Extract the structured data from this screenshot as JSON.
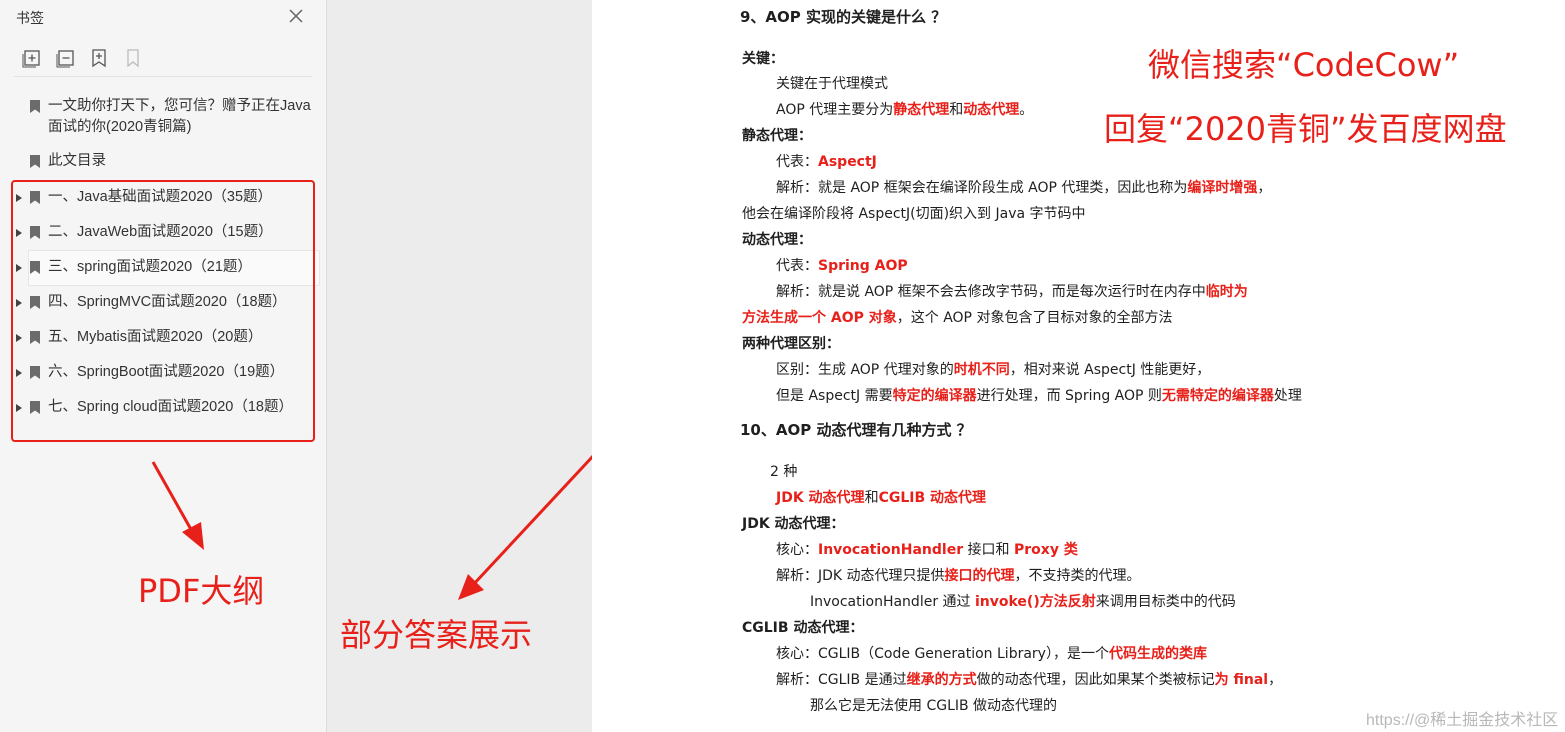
{
  "sidebar": {
    "title": "书签",
    "toolbar": [
      "expand-all-icon",
      "collapse-all-icon",
      "add-bookmark-icon",
      "bookmark-icon"
    ],
    "items": [
      {
        "label": "一文助你打天下，您可信？赠予正在Java面试的你(2020青铜篇)",
        "expandable": false
      },
      {
        "label": "此文目录",
        "expandable": false
      },
      {
        "label": "一、Java基础面试题2020（35题）",
        "expandable": true
      },
      {
        "label": "二、JavaWeb面试题2020（15题）",
        "expandable": true
      },
      {
        "label": "三、spring面试题2020（21题）",
        "expandable": true
      },
      {
        "label": "四、SpringMVC面试题2020（18题）",
        "expandable": true
      },
      {
        "label": "五、Mybatis面试题2020（20题）",
        "expandable": true
      },
      {
        "label": "六、SpringBoot面试题2020（19题）",
        "expandable": true
      },
      {
        "label": "七、Spring cloud面试题2020（18题）",
        "expandable": true
      }
    ]
  },
  "annotations": {
    "outline": "PDF大纲",
    "answers": "部分答案展示",
    "wechat_line1": "微信搜索“CodeCow”",
    "wechat_line2": "回复“2020青铜”发百度网盘",
    "watermark": "https://@稀土掘金技术社区"
  },
  "colors": {
    "accent_red": "#e8201a",
    "sidebar_bg": "#f5f5f5",
    "gutter_bg": "#ececec",
    "page_bg": "#ffffff"
  },
  "document": {
    "lines": [
      [
        {
          "t": "9、AOP 实现的关键是什么 ？",
          "s": "h"
        }
      ],
      [
        {
          "t": "关键：",
          "s": "b"
        }
      ],
      [
        {
          "t": "关键在于代理模式",
          "s": ""
        }
      ],
      [
        {
          "t": "AOP 代理主要分为",
          "s": ""
        },
        {
          "t": "静态代理",
          "s": "r"
        },
        {
          "t": "和",
          "s": ""
        },
        {
          "t": "动态代理",
          "s": "r"
        },
        {
          "t": "。",
          "s": ""
        }
      ],
      [
        {
          "t": "静态代理：",
          "s": "b"
        }
      ],
      [
        {
          "t": "代表：",
          "s": ""
        },
        {
          "t": "AspectJ",
          "s": "r"
        }
      ],
      [
        {
          "t": "解析：就是 AOP 框架会在编译阶段生成 AOP 代理类，因此也称为",
          "s": ""
        },
        {
          "t": "编译时增强",
          "s": "r"
        },
        {
          "t": "，",
          "s": ""
        }
      ],
      [
        {
          "t": "他会在编译阶段将 AspectJ(切面)织入到 Java 字节码中",
          "s": ""
        }
      ],
      [
        {
          "t": "动态代理：",
          "s": "b"
        }
      ],
      [
        {
          "t": "代表：",
          "s": ""
        },
        {
          "t": "Spring AOP",
          "s": "r"
        }
      ],
      [
        {
          "t": "解析：就是说 AOP 框架不会去修改字节码，而是每次运行时在内存中",
          "s": ""
        },
        {
          "t": "临时为",
          "s": "r"
        }
      ],
      [
        {
          "t": "方法生成一个 AOP 对象",
          "s": "r"
        },
        {
          "t": "，这个 AOP 对象包含了目标对象的全部方法",
          "s": ""
        }
      ],
      [
        {
          "t": "两种代理区别：",
          "s": "b"
        }
      ],
      [
        {
          "t": "区别：生成 AOP 代理对象的",
          "s": ""
        },
        {
          "t": "时机不同",
          "s": "r"
        },
        {
          "t": "，相对来说 AspectJ 性能更好，",
          "s": ""
        }
      ],
      [
        {
          "t": "但是 AspectJ 需要",
          "s": ""
        },
        {
          "t": "特定的编译器",
          "s": "r"
        },
        {
          "t": "进行处理，而 Spring AOP 则",
          "s": ""
        },
        {
          "t": "无需特定的编译器",
          "s": "r"
        },
        {
          "t": "处理",
          "s": ""
        }
      ],
      [
        {
          "t": "10、AOP 动态代理有几种方式 ？",
          "s": "h"
        }
      ],
      [
        {
          "t": "2 种",
          "s": ""
        }
      ],
      [
        {
          "t": "JDK 动态代理",
          "s": "r"
        },
        {
          "t": "和",
          "s": ""
        },
        {
          "t": "CGLIB 动态代理",
          "s": "r"
        }
      ],
      [
        {
          "t": "JDK 动态代理：",
          "s": "b"
        }
      ],
      [
        {
          "t": "核心：",
          "s": ""
        },
        {
          "t": "InvocationHandler",
          "s": "r"
        },
        {
          "t": " 接口和 ",
          "s": ""
        },
        {
          "t": "Proxy 类",
          "s": "r"
        }
      ],
      [
        {
          "t": "解析：JDK 动态代理只提供",
          "s": ""
        },
        {
          "t": "接口的代理",
          "s": "r"
        },
        {
          "t": "，不支持类的代理。",
          "s": ""
        }
      ],
      [
        {
          "t": "InvocationHandler  通过 ",
          "s": ""
        },
        {
          "t": "invoke()方法反射",
          "s": "r"
        },
        {
          "t": "来调用目标类中的代码",
          "s": ""
        }
      ],
      [
        {
          "t": "CGLIB 动态代理：",
          "s": "b"
        }
      ],
      [
        {
          "t": "核心：CGLIB（Code Generation Library），是一个",
          "s": ""
        },
        {
          "t": "代码生成的类库",
          "s": "r"
        }
      ],
      [
        {
          "t": "解析：CGLIB 是通过",
          "s": ""
        },
        {
          "t": "继承的方式",
          "s": "r"
        },
        {
          "t": "做的动态代理，因此如果某个类被标记",
          "s": ""
        },
        {
          "t": "为 final",
          "s": "r"
        },
        {
          "t": "，",
          "s": ""
        }
      ],
      [
        {
          "t": "那么它是无法使用 CGLIB 做动态代理的",
          "s": ""
        }
      ]
    ]
  }
}
